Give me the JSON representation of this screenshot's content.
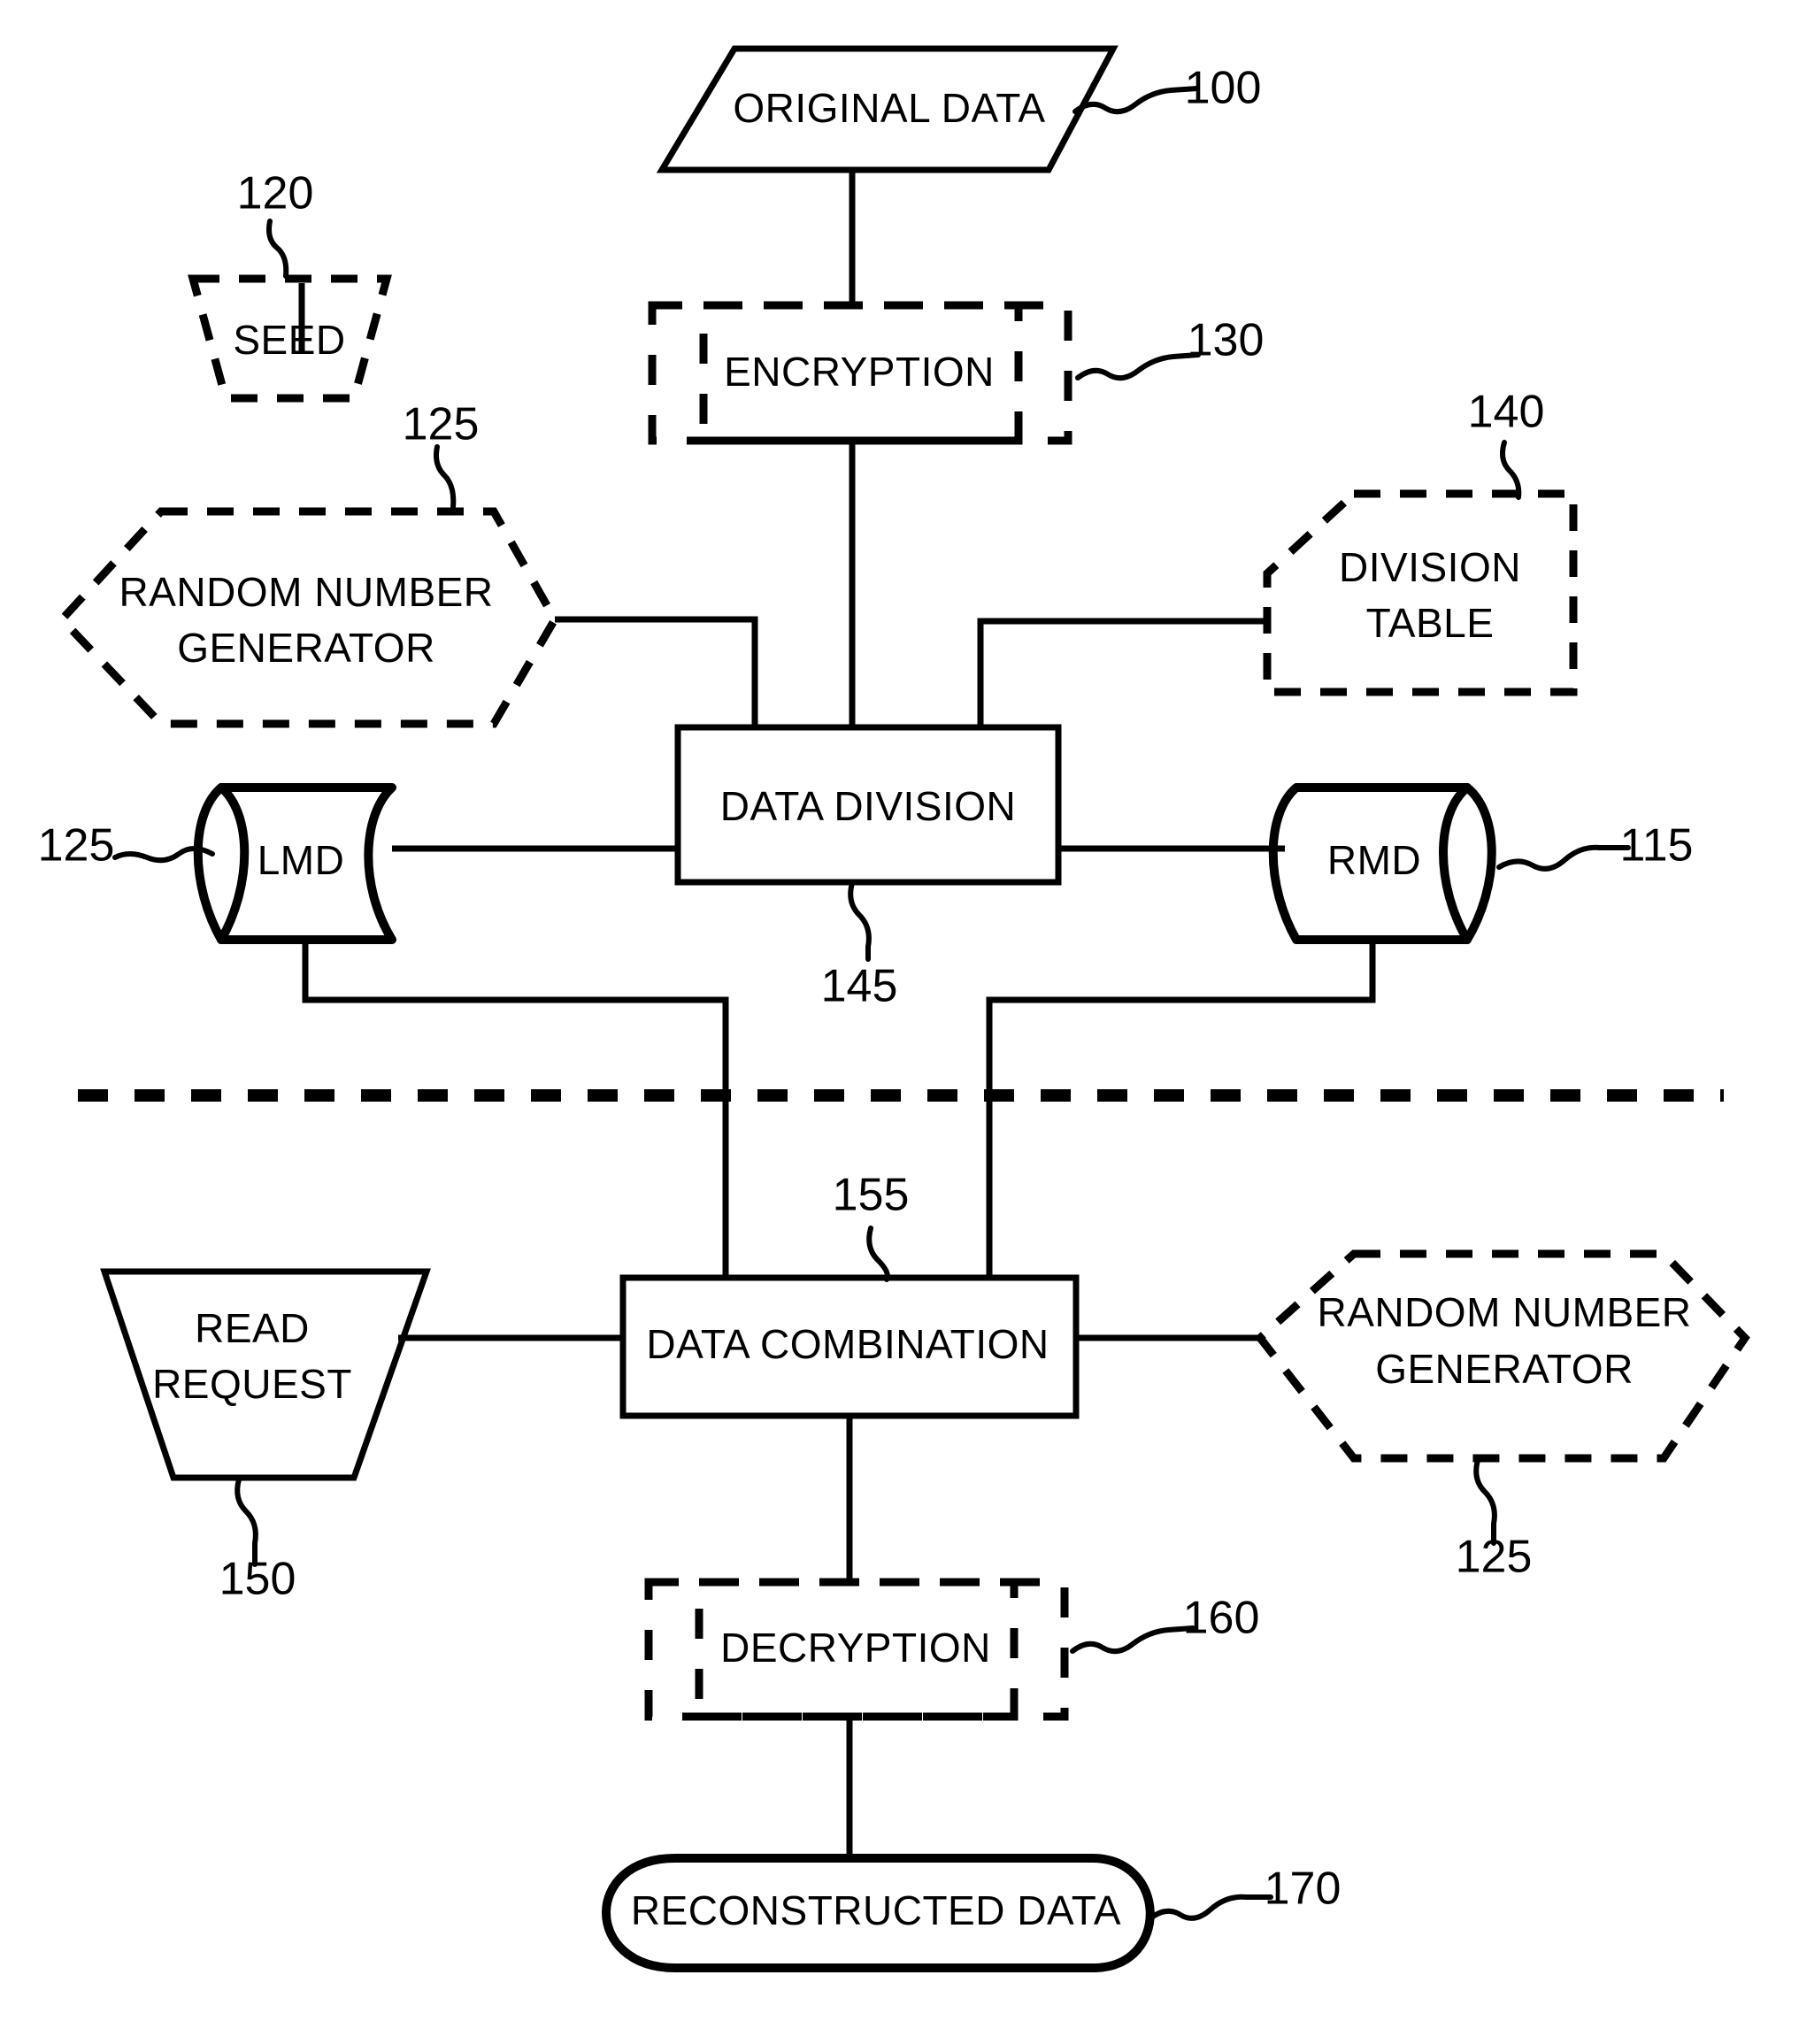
{
  "figure": {
    "type": "patent-flow-diagram",
    "background_color": "#ffffff",
    "line_color": "#000000"
  },
  "nodes": {
    "original_data": {
      "label": "ORIGINAL DATA",
      "ref": "100",
      "shape": "parallelogram",
      "style": "solid"
    },
    "seed": {
      "label": "SEED",
      "ref": "120",
      "shape": "trapezoid-down",
      "style": "dashed"
    },
    "rng_top": {
      "label_line1": "RANDOM NUMBER",
      "label_line2": "GENERATOR",
      "ref": "125",
      "shape": "hexagon",
      "style": "dashed"
    },
    "encryption": {
      "label": "ENCRYPTION",
      "ref": "130",
      "shape": "double-rectangle",
      "style": "dashed"
    },
    "division_table": {
      "label_line1": "DIVISION",
      "label_line2": "TABLE",
      "ref": "140",
      "shape": "document-corner-cut",
      "style": "dashed"
    },
    "data_division": {
      "label": "DATA DIVISION",
      "ref": "145",
      "shape": "rectangle",
      "style": "solid"
    },
    "lmd": {
      "label": "LMD",
      "ref": "125",
      "shape": "cylinder-left",
      "style": "solid"
    },
    "rmd": {
      "label": "RMD",
      "ref": "115",
      "shape": "cylinder-right",
      "style": "solid"
    },
    "read_request": {
      "label_line1": "READ",
      "label_line2": "REQUEST",
      "ref": "150",
      "shape": "trapezoid-down",
      "style": "solid"
    },
    "data_combination": {
      "label": "DATA COMBINATION",
      "ref": "155",
      "shape": "rectangle",
      "style": "solid"
    },
    "rng_bottom": {
      "label_line1": "RANDOM NUMBER",
      "label_line2": "GENERATOR",
      "ref": "125",
      "shape": "hexagon",
      "style": "dashed"
    },
    "decryption": {
      "label": "DECRYPTION",
      "ref": "160",
      "shape": "double-rectangle",
      "style": "dashed"
    },
    "reconstructed_data": {
      "label": "RECONSTRUCTED DATA",
      "ref": "170",
      "shape": "stadium",
      "style": "solid"
    }
  },
  "divider": {
    "name": "section-divider",
    "style": "thick-dashed",
    "orientation": "horizontal"
  }
}
